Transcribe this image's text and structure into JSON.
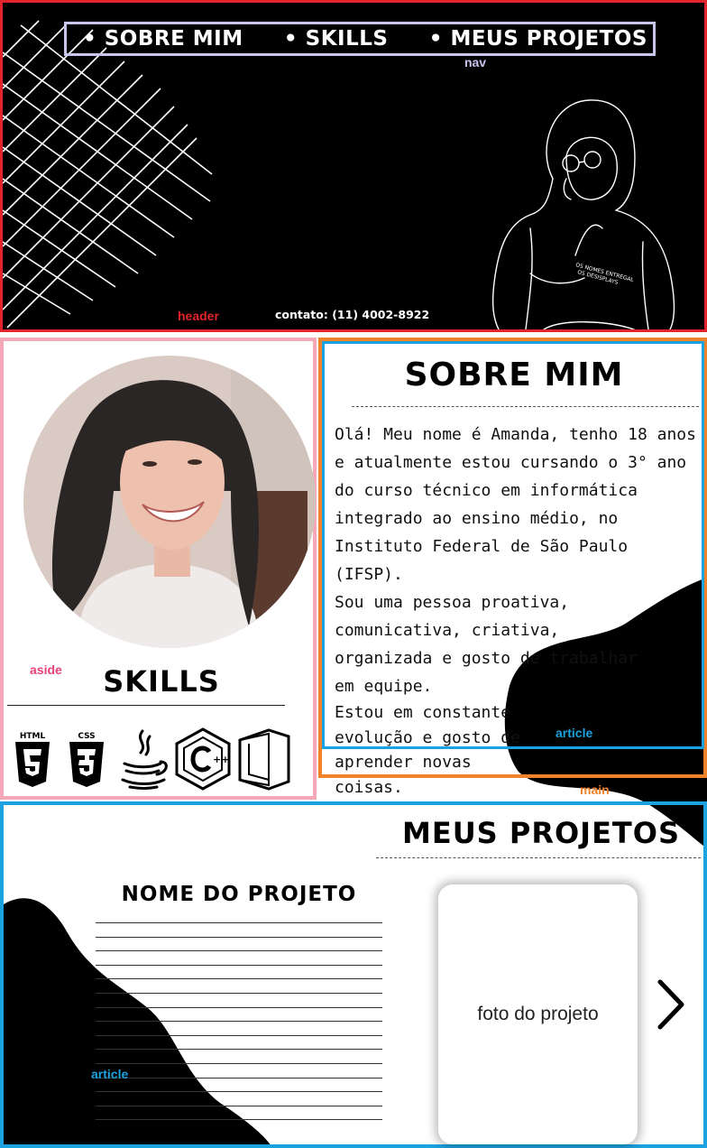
{
  "nav": {
    "items": [
      "SOBRE MIM",
      "SKILLS",
      "MEUS PROJETOS"
    ],
    "tag": "nav"
  },
  "header": {
    "contact": "contato: (11) 4002-8922",
    "tag": "header"
  },
  "aside": {
    "tag": "aside",
    "skills_title": "SKILLS",
    "skills": [
      {
        "icon": "html5-icon",
        "label": "HTML"
      },
      {
        "icon": "css3-icon",
        "label": "CSS"
      },
      {
        "icon": "java-icon"
      },
      {
        "icon": "cpp-icon"
      },
      {
        "icon": "office-icon"
      }
    ]
  },
  "about": {
    "title": "SOBRE MIM",
    "paragraph1": "Olá! Meu nome é Amanda, tenho 18 anos e atualmente estou cursando o 3° ano do curso técnico em informática integrado ao ensino médio, no Instituto Federal de São Paulo (IFSP).",
    "paragraph2": "Sou uma pessoa proativa, comunicativa, criativa, organizada e gosto de trabalhar em equipe.",
    "paragraph3": "Estou em constante evolução e gosto de aprender novas coisas.",
    "article_tag": "article",
    "main_tag": "main"
  },
  "projects": {
    "title": "MEUS PROJETOS",
    "project_name": "NOME DO PROJETO",
    "photo_placeholder": "foto do projeto",
    "article_tag": "article"
  },
  "colors": {
    "header_outline": "#e3242b",
    "nav_outline": "#c9c6ee",
    "aside_outline": "#f5a9b8",
    "main_outline": "#f0822a",
    "article_outline": "#1aa3e0"
  }
}
